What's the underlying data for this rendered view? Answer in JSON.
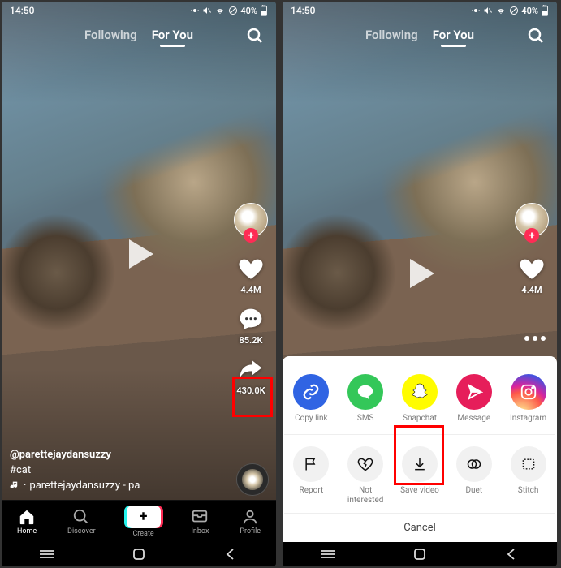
{
  "status": {
    "time": "14:50",
    "battery": "40%"
  },
  "tabs": {
    "following": "Following",
    "foryou": "For You"
  },
  "actions": {
    "likes": "4.4M",
    "comments": "85.2K",
    "shares": "430.0K"
  },
  "caption": {
    "user": "@parettejaydansuzzy",
    "hashtag": "#cat",
    "music": "parettejaydansuzzy - pa"
  },
  "nav": {
    "home": "Home",
    "discover": "Discover",
    "create": "Create",
    "inbox": "Inbox",
    "profile": "Profile"
  },
  "share": {
    "row1": [
      {
        "id": "copy",
        "label": "Copy link"
      },
      {
        "id": "sms",
        "label": "SMS"
      },
      {
        "id": "snap",
        "label": "Snapchat"
      },
      {
        "id": "msg",
        "label": "Message"
      },
      {
        "id": "ig",
        "label": "Instagram"
      }
    ],
    "row2": [
      {
        "id": "report",
        "label": "Report"
      },
      {
        "id": "notint",
        "label": "Not\ninterested"
      },
      {
        "id": "save",
        "label": "Save video"
      },
      {
        "id": "duet",
        "label": "Duet"
      },
      {
        "id": "stitch",
        "label": "Stitch"
      }
    ],
    "cancel": "Cancel"
  }
}
